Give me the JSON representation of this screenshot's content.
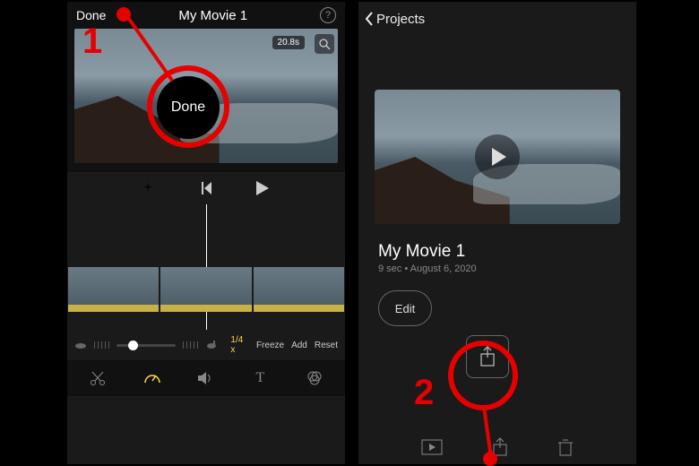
{
  "annotations": {
    "step1": "1",
    "step2": "2",
    "popup_text": "Done"
  },
  "editor": {
    "done": "Done",
    "title": "My Movie 1",
    "timecode": "20.8s",
    "speed": {
      "rate": "1/4 x",
      "freeze": "Freeze",
      "add": "Add",
      "reset": "Reset"
    }
  },
  "project": {
    "back": "Projects",
    "title": "My Movie 1",
    "meta": "9 sec • August 6, 2020",
    "edit": "Edit"
  }
}
